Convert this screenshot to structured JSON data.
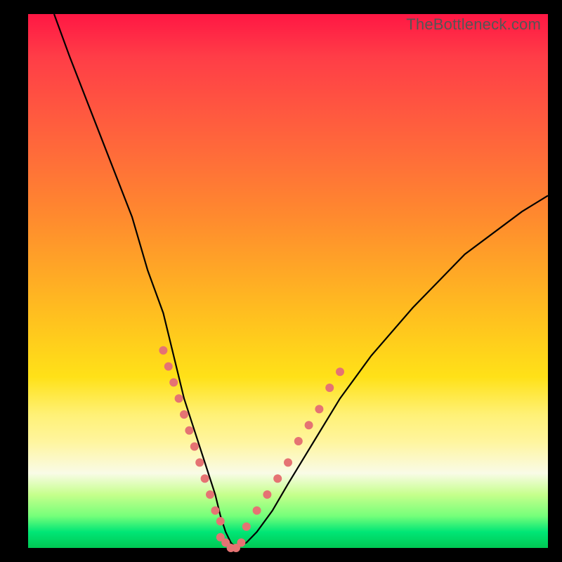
{
  "watermark": "TheBottleneck.com",
  "chart_data": {
    "type": "line",
    "title": "",
    "xlabel": "",
    "ylabel": "",
    "xlim": [
      0,
      100
    ],
    "ylim": [
      0,
      100
    ],
    "series": [
      {
        "name": "bottleneck-curve",
        "x": [
          5,
          8,
          12,
          16,
          20,
          23,
          26,
          28,
          30,
          32,
          34,
          36,
          37,
          38,
          39,
          40,
          42,
          44,
          47,
          50,
          55,
          60,
          66,
          74,
          84,
          95,
          100
        ],
        "y": [
          100,
          92,
          82,
          72,
          62,
          52,
          44,
          36,
          28,
          22,
          16,
          10,
          6,
          3,
          1,
          0,
          1,
          3,
          7,
          12,
          20,
          28,
          36,
          45,
          55,
          63,
          66
        ]
      }
    ],
    "highlight_band_y": [
      0,
      30
    ],
    "highlight_dots": {
      "left": {
        "x": [
          26,
          27,
          28,
          29,
          30,
          31,
          32,
          33,
          34,
          35,
          36,
          37
        ],
        "y": [
          37,
          34,
          31,
          28,
          25,
          22,
          19,
          16,
          13,
          10,
          7,
          5
        ]
      },
      "right": {
        "x": [
          42,
          44,
          46,
          48,
          50,
          52,
          54,
          56,
          58,
          60
        ],
        "y": [
          4,
          7,
          10,
          13,
          16,
          20,
          23,
          26,
          30,
          33
        ]
      },
      "bottom": {
        "x": [
          37,
          38,
          39,
          40,
          41
        ],
        "y": [
          2,
          1,
          0,
          0,
          1
        ]
      }
    },
    "colors": {
      "curve": "#000000",
      "dots": "#e57373",
      "gradient_top": "#ff1744",
      "gradient_bottom": "#00c853"
    }
  }
}
